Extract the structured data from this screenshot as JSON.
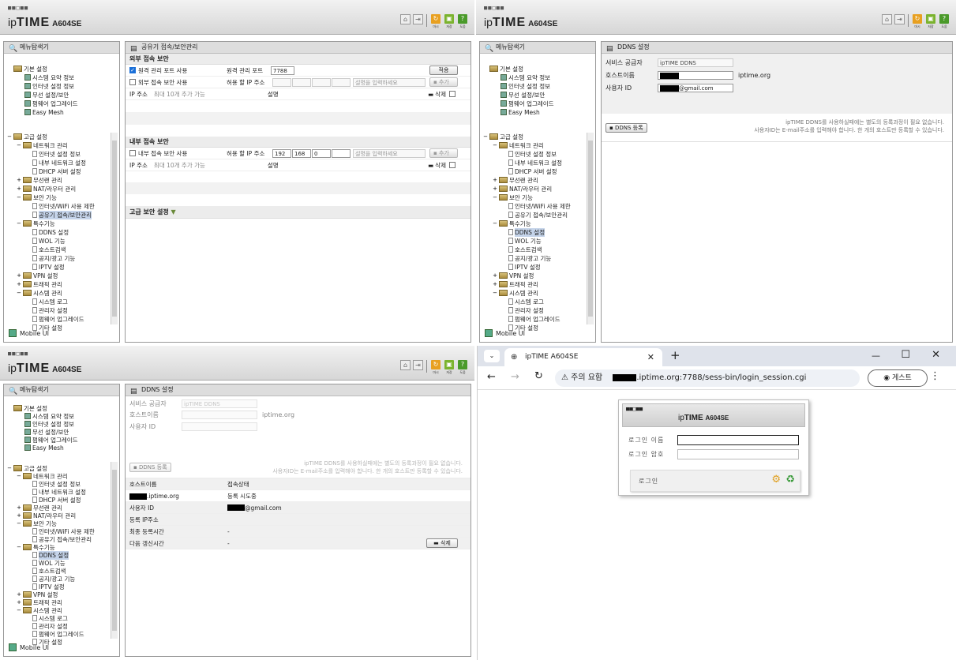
{
  "header": {
    "dots": "■■□■■",
    "brand": "ip",
    "brand_bold": "TIME",
    "model": "A604SE",
    "icon_labels": [
      "마시",
      "저장",
      "도움"
    ]
  },
  "menu": {
    "title": "메뉴탐색기",
    "basic": {
      "label": "기본 설정",
      "items": [
        "시스템 요약 정보",
        "인터넷 설정 정보",
        "무선 설정/보안",
        "펌웨어 업그레이드",
        "Easy Mesh"
      ]
    },
    "advanced": {
      "label": "고급 설정",
      "network": {
        "label": "네트워크 관리",
        "items": [
          "인터넷 설정 정보",
          "내부 네트워크 설정",
          "DHCP 서버 설정"
        ]
      },
      "wireless": "무선랜 관리",
      "nat": "NAT/라우터 관리",
      "security": {
        "label": "보안 기능",
        "items": [
          "인터넷/WiFi 사용 제한",
          "공유기 접속/보안관리"
        ]
      },
      "special": {
        "label": "특수기능",
        "items": [
          "DDNS 설정",
          "WOL 기능",
          "호스트검색",
          "공지/광고 기능",
          "IPTV 설정"
        ]
      },
      "vpn": "VPN 설정",
      "traffic": "트래픽 관리",
      "system": {
        "label": "시스템 관리",
        "items": [
          "시스템 로그",
          "관리자 설정",
          "펌웨어 업그레이드",
          "기타 설정"
        ]
      }
    },
    "mobile": "Mobile UI"
  },
  "security_page": {
    "title": "공유기 접속/보안관리",
    "external": {
      "section": "외부 접속 보안",
      "remote_port_check": "원격 관리 포트 사용",
      "remote_port_label": "원격 관리 포트",
      "remote_port_value": "7788",
      "apply": "적용",
      "access_check": "외부 접속 보안 사용",
      "allow_ip": "허용 할 IP 주소",
      "desc_placeholder": "설명을 입력하세요",
      "add": "추가",
      "ip_col": "IP 주소",
      "max_note": "최대 10개 추가 가능",
      "desc_col": "설명",
      "delete": "삭제"
    },
    "internal": {
      "section": "내부 접속 보안",
      "access_check": "내부 접속 보안 사용",
      "allow_ip": "허용 할 IP 주소",
      "ip1": "192",
      "ip2": "168",
      "ip3": "0",
      "desc_placeholder": "설명을 입력하세요",
      "add": "추가",
      "ip_col": "IP 주소",
      "max_note": "최대 10개 추가 가능",
      "desc_col": "설명",
      "delete": "삭제"
    },
    "advanced": "고급 보안 설정"
  },
  "ddns": {
    "title": "DDNS 설정",
    "provider_label": "서비스 공급자",
    "provider_value": "ipTIME DDNS",
    "host_label": "호스트이름",
    "host_suffix": "iptime.org",
    "user_label": "사용자 ID",
    "user_value": "@gmail.com",
    "register": "DDNS 등록",
    "note1": "ipTIME DDNS를 사용하실때에는 별도의 등록과정이 필요 없습니다.",
    "note2": "사용자ID는 E-mail주소를 입력해야 합니다. 한 개의 호스트만 등록할 수 있습니다.",
    "table": {
      "host_col": "호스트이름",
      "status_col": "접속상태",
      "host_value": ".iptime.org",
      "status_value": "등록 시도중",
      "user_label": "사용자 ID",
      "user_value": "@gmail.com",
      "reg_ip": "등록 IP주소",
      "last_reg": "최종 등록시간",
      "last_reg_value": "-",
      "next_update": "다음 갱신시간",
      "next_update_value": "-",
      "delete": "삭제"
    }
  },
  "browser": {
    "tab_title": "ipTIME A604SE",
    "new_tab": "+",
    "warning": "주의 요함",
    "url": ".iptime.org:7788/sess-bin/login_session.cgi",
    "guest": "게스트",
    "window_controls": [
      "—",
      "☐",
      "✕"
    ],
    "login": {
      "model": "A604SE",
      "name_label": "로그인 이름",
      "pw_label": "로그인 암호",
      "button": "로그인"
    }
  }
}
